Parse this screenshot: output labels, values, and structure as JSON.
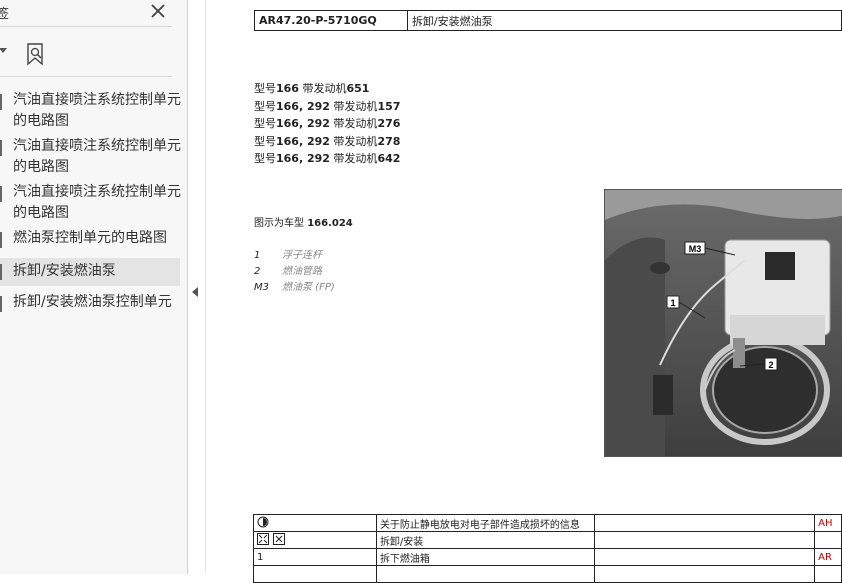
{
  "sidebar": {
    "title": "签",
    "items": [
      {
        "label": "汽油直接喷注系统控制单元的电路图"
      },
      {
        "label": "汽油直接喷注系统控制单元的电路图"
      },
      {
        "label": "汽油直接喷注系统控制单元的电路图"
      },
      {
        "label": "燃油泵控制单元的电路图"
      },
      {
        "label": "拆卸/安装燃油泵"
      },
      {
        "label": "拆卸/安装燃油泵控制单元"
      }
    ]
  },
  "document": {
    "header": {
      "code": "AR47.20-P-5710GQ",
      "title": "拆卸/安装燃油泵"
    },
    "models": [
      {
        "prefix": "型号",
        "model": "166",
        "mid": " 带发动机",
        "engine": "651"
      },
      {
        "prefix": "型号",
        "model": "166, 292",
        "mid": " 带发动机",
        "engine": "157"
      },
      {
        "prefix": "型号",
        "model": "166, 292",
        "mid": " 带发动机",
        "engine": "276"
      },
      {
        "prefix": "型号",
        "model": "166, 292",
        "mid": " 带发动机",
        "engine": "278"
      },
      {
        "prefix": "型号",
        "model": "166, 292",
        "mid": " 带发动机",
        "engine": "642"
      }
    ],
    "figure_note": {
      "text": "图示为车型 ",
      "model": "166.024"
    },
    "legend": [
      {
        "num": "1",
        "text": "浮子连杆"
      },
      {
        "num": "2",
        "text": "燃油管路"
      },
      {
        "num": "M3",
        "text": "燃油泵 (FP)"
      }
    ],
    "photo_labels": {
      "m3": "M3",
      "one": "1",
      "two": "2"
    },
    "steps": [
      {
        "num": "",
        "text": "关于防止静电放电对电子部件造成损坏的信息",
        "ref": "AH"
      },
      {
        "num": "",
        "text": "拆卸/安装",
        "ref": ""
      },
      {
        "num": "1",
        "text": "拆下燃油箱",
        "ref": "AR"
      }
    ]
  }
}
